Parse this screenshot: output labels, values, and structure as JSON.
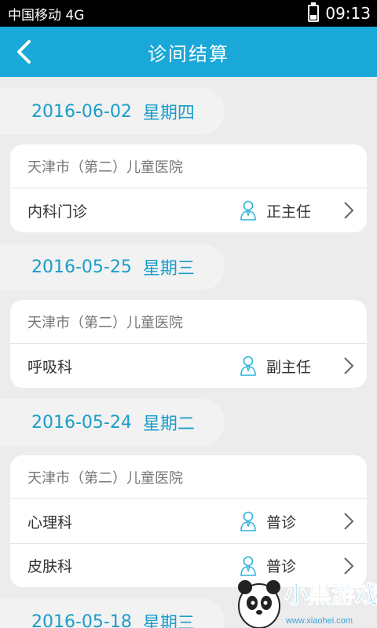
{
  "status_bar": {
    "carrier": "中国移动 4G",
    "time": "09:13"
  },
  "app_bar": {
    "title": "诊间结算"
  },
  "accent_color": "#19a8d8",
  "groups": [
    {
      "date": "2016-06-02",
      "weekday": "星期四",
      "hospital": "天津市（第二）儿童医院",
      "items": [
        {
          "department": "内科门诊",
          "doctor_level": "正主任"
        }
      ]
    },
    {
      "date": "2016-05-25",
      "weekday": "星期三",
      "hospital": "天津市（第二）儿童医院",
      "items": [
        {
          "department": "呼吸科",
          "doctor_level": "副主任"
        }
      ]
    },
    {
      "date": "2016-05-24",
      "weekday": "星期二",
      "hospital": "天津市（第二）儿童医院",
      "items": [
        {
          "department": "心理科",
          "doctor_level": "普诊"
        },
        {
          "department": "皮肤科",
          "doctor_level": "普诊"
        }
      ]
    },
    {
      "date": "2016-05-18",
      "weekday": "星期三"
    }
  ],
  "watermark": {
    "text": "小黑游戏",
    "url": "www.xiaohei.com"
  }
}
